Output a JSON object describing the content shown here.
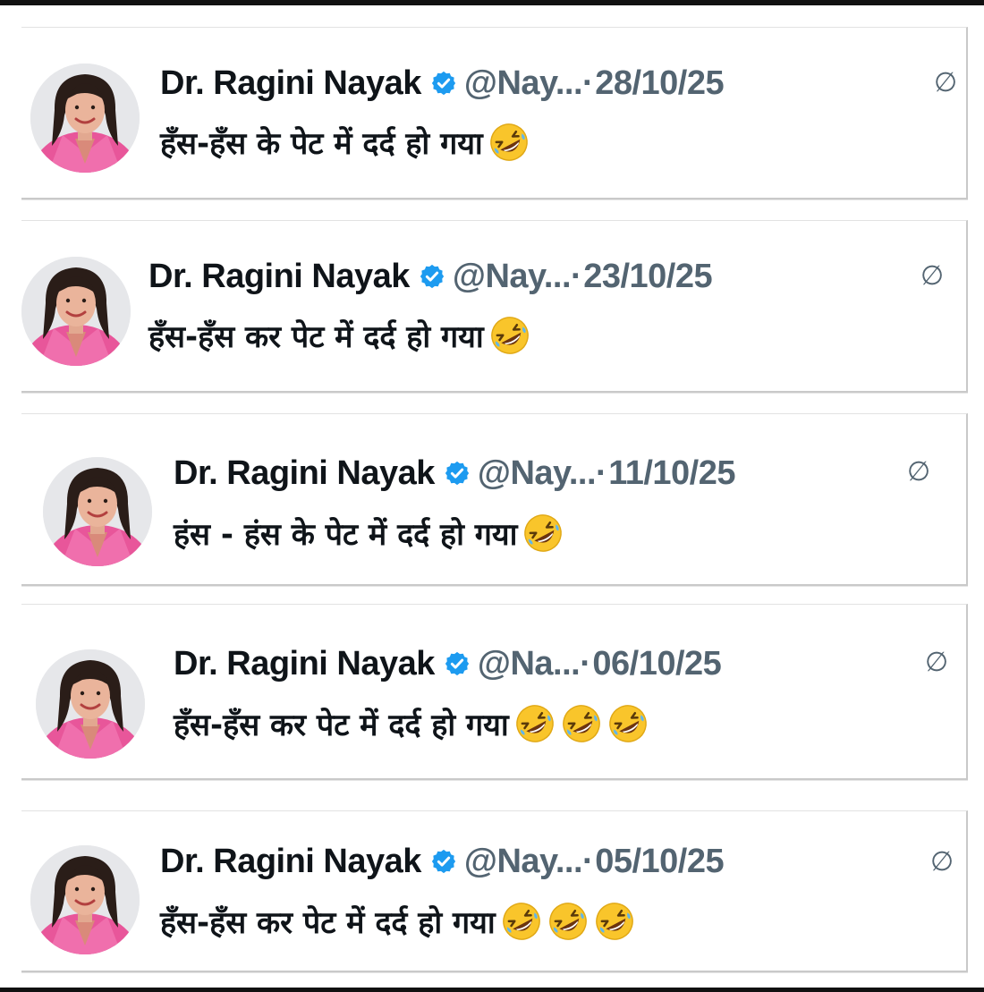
{
  "tweets": [
    {
      "name": "Dr. Ragini Nayak",
      "handle": "@Nay...",
      "separator": "·",
      "date": "28/10/25",
      "text": "हँस-हँस के पेट में दर्द हो गया",
      "emoji": "rolling-on-floor-laughing",
      "emoji_count": 1
    },
    {
      "name": "Dr. Ragini Nayak",
      "handle": "@Nay...",
      "separator": "·",
      "date": "23/10/25",
      "text": "हँस-हँस कर पेट में दर्द हो गया",
      "emoji": "rolling-on-floor-laughing",
      "emoji_count": 1
    },
    {
      "name": "Dr. Ragini Nayak",
      "handle": "@Nay...",
      "separator": "·",
      "date": "11/10/25",
      "text": "हंस - हंस के पेट में दर्द हो गया",
      "emoji": "rolling-on-floor-laughing",
      "emoji_count": 1
    },
    {
      "name": "Dr. Ragini Nayak",
      "handle": "@Na...",
      "separator": "·",
      "date": "06/10/25",
      "text": "हँस-हँस कर पेट में दर्द हो गया",
      "emoji": "rolling-on-floor-laughing",
      "emoji_count": 3
    },
    {
      "name": "Dr. Ragini Nayak",
      "handle": "@Nay...",
      "separator": "·",
      "date": "05/10/25",
      "text": "हँस-हँस कर पेट में दर्द हो गया",
      "emoji": "rolling-on-floor-laughing",
      "emoji_count": 3
    }
  ],
  "colors": {
    "verified": "#1d9bf0",
    "secondary_text": "#536471",
    "primary_text": "#0f1419",
    "emoji_face": "#f9c52b"
  }
}
